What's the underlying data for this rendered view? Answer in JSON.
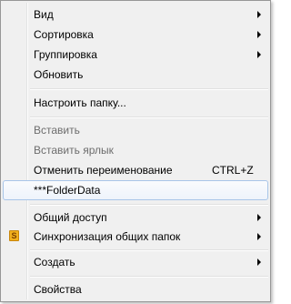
{
  "menu": {
    "items": [
      {
        "label": "Вид",
        "has_submenu": true
      },
      {
        "label": "Сортировка",
        "has_submenu": true
      },
      {
        "label": "Группировка",
        "has_submenu": true
      },
      {
        "label": "Обновить"
      },
      {
        "label": "Настроить папку..."
      },
      {
        "label": "Вставить",
        "disabled": true
      },
      {
        "label": "Вставить ярлык",
        "disabled": true
      },
      {
        "label": "Отменить переименование",
        "shortcut": "CTRL+Z"
      },
      {
        "label": "***FolderData",
        "highlighted": true
      },
      {
        "label": "Общий доступ",
        "has_submenu": true
      },
      {
        "label": "Синхронизация общих папок",
        "has_submenu": true,
        "icon": "sync-folder-icon",
        "icon_glyph": "S"
      },
      {
        "label": "Создать",
        "has_submenu": true
      },
      {
        "label": "Свойства"
      }
    ]
  }
}
